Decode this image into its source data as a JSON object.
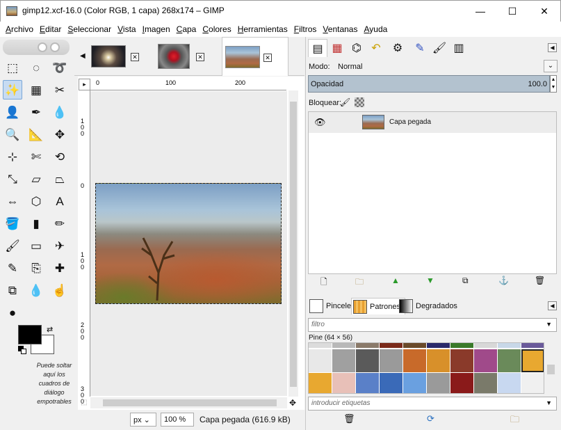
{
  "window": {
    "title": "gimp12.xcf-16.0 (Color RGB, 1 capa) 268x174 – GIMP",
    "minimize": "—",
    "maximize": "☐",
    "close": "✕"
  },
  "menu": [
    "Archivo",
    "Editar",
    "Seleccionar",
    "Vista",
    "Imagen",
    "Capa",
    "Colores",
    "Herramientas",
    "Filtros",
    "Ventanas",
    "Ayuda"
  ],
  "toolbox": {
    "tools": [
      {
        "name": "rect-select",
        "glyph": "⬚"
      },
      {
        "name": "ellipse-select",
        "glyph": "◌"
      },
      {
        "name": "free-select",
        "glyph": "➰"
      },
      {
        "name": "fuzzy-select",
        "glyph": "✨"
      },
      {
        "name": "select-by-color",
        "glyph": "▦"
      },
      {
        "name": "scissors-select",
        "glyph": "✂"
      },
      {
        "name": "foreground-select",
        "glyph": "👤"
      },
      {
        "name": "paths",
        "glyph": "✒"
      },
      {
        "name": "color-picker",
        "glyph": "💧"
      },
      {
        "name": "zoom",
        "glyph": "🔍"
      },
      {
        "name": "measure",
        "glyph": "📐"
      },
      {
        "name": "move",
        "glyph": "✥"
      },
      {
        "name": "align",
        "glyph": "⊹"
      },
      {
        "name": "crop",
        "glyph": "✄"
      },
      {
        "name": "rotate",
        "glyph": "⟲"
      },
      {
        "name": "scale",
        "glyph": "⤡"
      },
      {
        "name": "shear",
        "glyph": "▱"
      },
      {
        "name": "perspective",
        "glyph": "⏢"
      },
      {
        "name": "flip",
        "glyph": "⇔"
      },
      {
        "name": "cage",
        "glyph": "⬡"
      },
      {
        "name": "text",
        "glyph": "A"
      },
      {
        "name": "bucket-fill",
        "glyph": "🪣"
      },
      {
        "name": "blend",
        "glyph": "▮"
      },
      {
        "name": "pencil",
        "glyph": "✏"
      },
      {
        "name": "paintbrush",
        "glyph": "🖌"
      },
      {
        "name": "eraser",
        "glyph": "▭"
      },
      {
        "name": "airbrush",
        "glyph": "✈"
      },
      {
        "name": "ink",
        "glyph": "✎"
      },
      {
        "name": "clone",
        "glyph": "⎘"
      },
      {
        "name": "heal",
        "glyph": "✚"
      },
      {
        "name": "perspective-clone",
        "glyph": "⧉"
      },
      {
        "name": "blur-sharpen",
        "glyph": "💧"
      },
      {
        "name": "smudge",
        "glyph": "☝"
      },
      {
        "name": "dodge-burn",
        "glyph": "●"
      }
    ],
    "drop_hint": "Puede soltar aquí los cuadros de diálogo empotrables"
  },
  "image_tabs": [
    {
      "name": "image-tab-1",
      "close": "✕"
    },
    {
      "name": "image-tab-2",
      "close": "✕"
    },
    {
      "name": "image-tab-3",
      "close": "✕"
    }
  ],
  "rulers": {
    "h": [
      "0",
      "100",
      "200"
    ],
    "v": [
      "100",
      "0",
      "100",
      "200",
      "300"
    ]
  },
  "statusbar": {
    "unit": "px",
    "zoom": "100 %",
    "text": "Capa pegada (616.9 kB)"
  },
  "layers": {
    "mode_label": "Modo:",
    "mode_value": "Normal",
    "opacity_label": "Opacidad",
    "opacity_value": "100.0",
    "opacity_fraction": 1.0,
    "lock_label": "Bloquear:",
    "items": [
      {
        "name": "Capa pegada",
        "visible": true
      }
    ]
  },
  "resources": {
    "tabs": [
      "Pinceles",
      "Patrones",
      "Degradados"
    ],
    "active_tab": "Patrones",
    "filter_placeholder": "filtro",
    "pattern_name": "Pine (64 × 56)",
    "tags_placeholder": "introducir etiquetas"
  }
}
